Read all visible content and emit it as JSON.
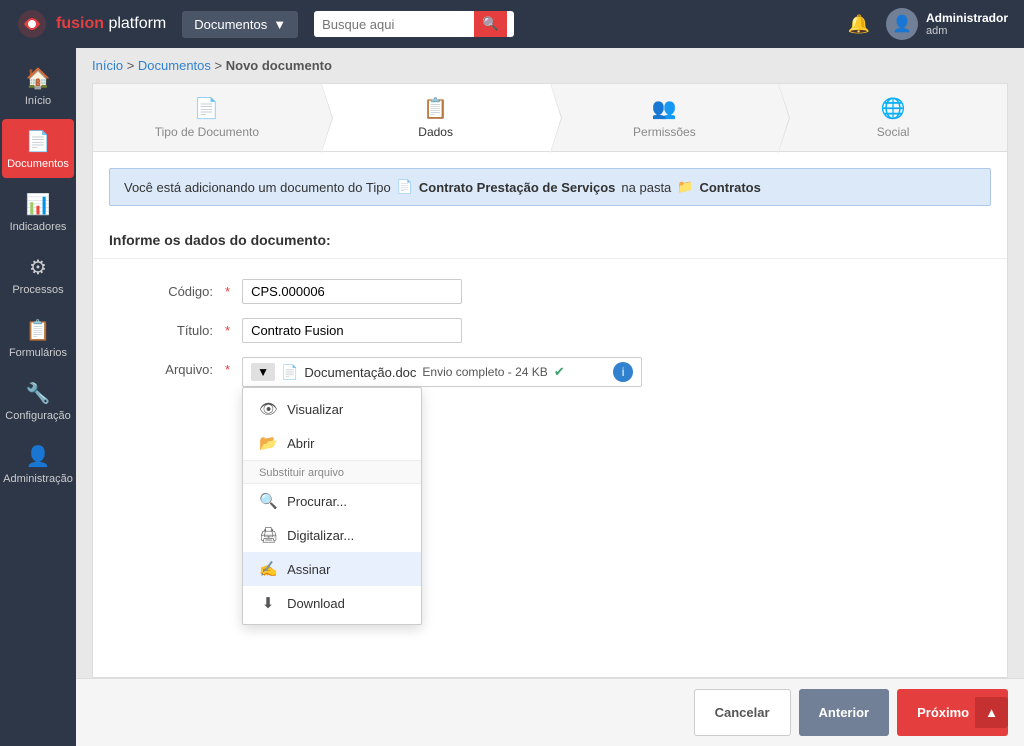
{
  "app": {
    "logo_fusion": "fusion",
    "logo_platform": "platform"
  },
  "topnav": {
    "menu_label": "Documentos",
    "search_placeholder": "Busque aqui",
    "user_name": "Administrador",
    "user_role": "adm"
  },
  "breadcrumb": {
    "inicio": "Início",
    "sep1": " > ",
    "documentos": "Documentos",
    "sep2": " > ",
    "current": "Novo documento"
  },
  "wizard": {
    "tabs": [
      {
        "id": "tipo",
        "icon": "📄",
        "label": "Tipo de Documento",
        "active": false
      },
      {
        "id": "dados",
        "icon": "📋",
        "label": "Dados",
        "active": true
      },
      {
        "id": "permissoes",
        "icon": "👥",
        "label": "Permissões",
        "active": false
      },
      {
        "id": "social",
        "icon": "🌐",
        "label": "Social",
        "active": false
      }
    ]
  },
  "info_banner": {
    "text_prefix": "Você está adicionando um documento do Tipo",
    "tipo_icon": "📄",
    "tipo_label": "Contrato Prestação de Serviços",
    "text_mid": "na pasta",
    "pasta_icon": "📁",
    "pasta_label": "Contratos"
  },
  "form": {
    "section_title": "Informe os dados do documento:",
    "code_label": "Código:",
    "code_value": "CPS.000006",
    "title_label": "Título:",
    "title_value": "Contrato Fusion",
    "file_label": "Arquivo:",
    "file_name": "Documentação.doc",
    "file_status": "Envio completo - 24 KB",
    "file_dropdown_btn": "▼",
    "file_info_btn": "i"
  },
  "dropdown_menu": {
    "items": [
      {
        "id": "visualizar",
        "icon": "👁",
        "label": "Visualizar",
        "highlighted": false
      },
      {
        "id": "abrir",
        "icon": "📂",
        "label": "Abrir",
        "highlighted": false
      },
      {
        "id": "substituir_label",
        "label": "Substituir arquivo",
        "is_divider": true
      },
      {
        "id": "procurar",
        "icon": "🔍",
        "label": "Procurar...",
        "highlighted": false
      },
      {
        "id": "digitalizar",
        "icon": "🖨",
        "label": "Digitalizar...",
        "highlighted": false
      },
      {
        "id": "assinar",
        "icon": "✍",
        "label": "Assinar",
        "highlighted": true
      },
      {
        "id": "download",
        "icon": "⬇",
        "label": "Download",
        "highlighted": false
      }
    ]
  },
  "footer": {
    "cancel_label": "Cancelar",
    "prev_label": "Anterior",
    "next_label": "Próximo"
  },
  "sidebar": {
    "items": [
      {
        "id": "inicio",
        "icon": "🏠",
        "label": "Início",
        "active": false
      },
      {
        "id": "documentos",
        "icon": "📄",
        "label": "Documentos",
        "active": true
      },
      {
        "id": "indicadores",
        "icon": "📊",
        "label": "Indicadores",
        "active": false
      },
      {
        "id": "processos",
        "icon": "⚙",
        "label": "Processos",
        "active": false
      },
      {
        "id": "formularios",
        "icon": "📋",
        "label": "Formulários",
        "active": false
      },
      {
        "id": "configuracao",
        "icon": "🔧",
        "label": "Configuração",
        "active": false
      },
      {
        "id": "administracao",
        "icon": "👤",
        "label": "Administração",
        "active": false
      }
    ]
  }
}
